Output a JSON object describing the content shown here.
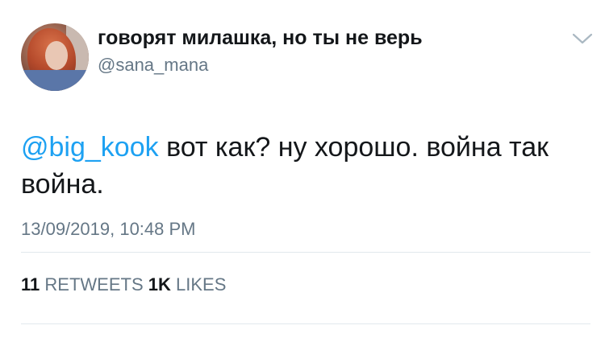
{
  "user": {
    "display_name": "говорят милашка, но ты не верь",
    "handle": "@sana_mana",
    "avatar_icon": "profile-photo"
  },
  "tweet": {
    "mention": "@big_kook",
    "text": " вот как? ну хорошо. война так война.",
    "timestamp": "13/09/2019, 10:48 PM"
  },
  "stats": {
    "retweets_count": "11",
    "retweets_label": "RETWEETS",
    "likes_count": "1K",
    "likes_label": "LIKES"
  },
  "colors": {
    "mention": "#1da1f2",
    "secondary_text": "#657786",
    "primary_text": "#14171a",
    "divider": "#e1e8ed"
  },
  "icons": {
    "menu": "chevron-down-icon"
  }
}
